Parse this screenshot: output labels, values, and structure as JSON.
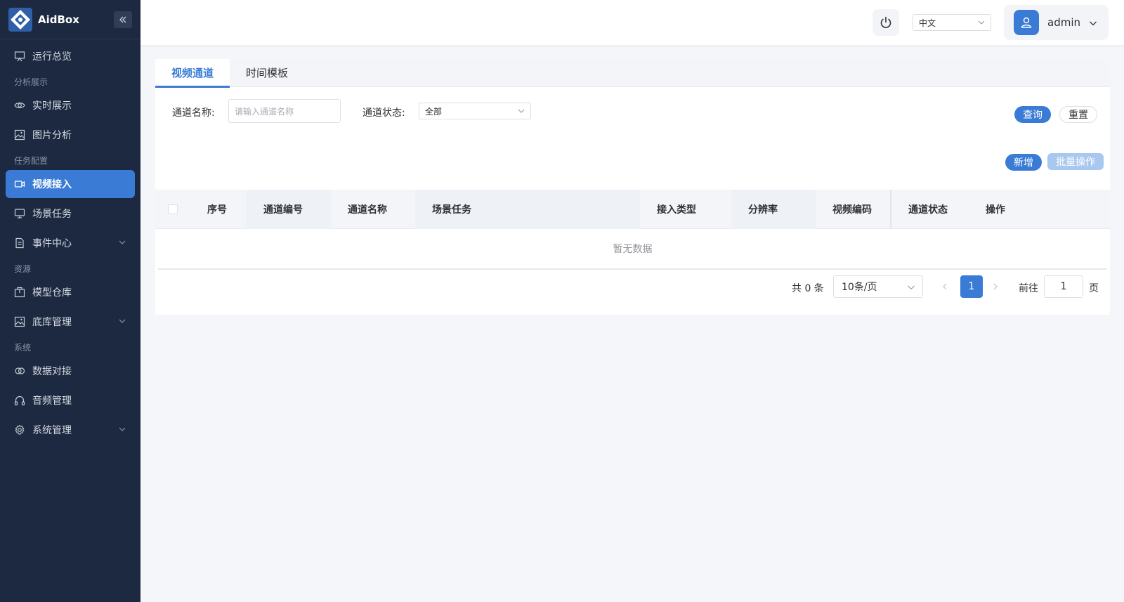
{
  "app": {
    "name": "AidBox",
    "collapse_icon": "double-chevron-left-icon"
  },
  "colors": {
    "sidebar_bg": "#1c2940",
    "accent": "#3a7bd5",
    "page_bg": "#f4f6fa"
  },
  "sidebar": {
    "items": [
      {
        "type": "item",
        "label": "运行总览",
        "icon": "presentation-icon"
      },
      {
        "type": "group",
        "label": "分析展示"
      },
      {
        "type": "item",
        "label": "实时展示",
        "icon": "eye-icon"
      },
      {
        "type": "item",
        "label": "图片分析",
        "icon": "image-icon"
      },
      {
        "type": "group",
        "label": "任务配置"
      },
      {
        "type": "item",
        "label": "视频接入",
        "icon": "video-camera-icon",
        "active": true
      },
      {
        "type": "item",
        "label": "场景任务",
        "icon": "monitor-icon"
      },
      {
        "type": "item",
        "label": "事件中心",
        "icon": "document-icon",
        "expandable": true
      },
      {
        "type": "group",
        "label": "资源"
      },
      {
        "type": "item",
        "label": "模型仓库",
        "icon": "package-icon"
      },
      {
        "type": "item",
        "label": "底库管理",
        "icon": "image-icon",
        "expandable": true
      },
      {
        "type": "group",
        "label": "系统"
      },
      {
        "type": "item",
        "label": "数据对接",
        "icon": "link-icon"
      },
      {
        "type": "item",
        "label": "音频管理",
        "icon": "headphones-icon"
      },
      {
        "type": "item",
        "label": "系统管理",
        "icon": "gear-icon",
        "expandable": true
      }
    ]
  },
  "header": {
    "power_icon": "power-icon",
    "language": "中文",
    "user": {
      "name": "admin",
      "avatar_icon": "user-icon"
    }
  },
  "tabs": [
    {
      "label": "视频通道",
      "active": true
    },
    {
      "label": "时间模板",
      "active": false
    }
  ],
  "filters": {
    "name_label": "通道名称:",
    "name_placeholder": "请输入通道名称",
    "status_label": "通道状态:",
    "status_value": "全部",
    "query_label": "查询",
    "reset_label": "重置"
  },
  "actions": {
    "add_label": "新增",
    "batch_label": "批量操作"
  },
  "table": {
    "columns": [
      "序号",
      "通道编号",
      "通道名称",
      "场景任务",
      "接入类型",
      "分辨率",
      "视频编码",
      "通道状态",
      "操作"
    ],
    "empty_text": "暂无数据"
  },
  "pagination": {
    "total_text": "共 0 条",
    "page_size": "10条/页",
    "current_page": "1",
    "goto_label": "前往",
    "goto_value": "1",
    "page_suffix": "页"
  }
}
